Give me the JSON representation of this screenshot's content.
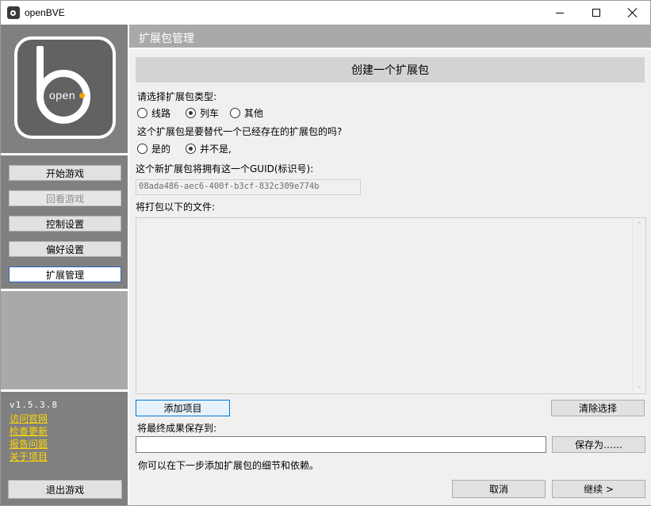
{
  "window": {
    "title": "openBVE"
  },
  "sidebar": {
    "logo_text": "open",
    "nav": [
      {
        "label": "开始游戏",
        "state": "normal"
      },
      {
        "label": "回看游戏",
        "state": "disabled"
      },
      {
        "label": "控制设置",
        "state": "normal"
      },
      {
        "label": "偏好设置",
        "state": "normal"
      },
      {
        "label": "扩展管理",
        "state": "active"
      }
    ],
    "version": "v1.5.3.8",
    "links": [
      "访问官网",
      "检查更新",
      "报告问题",
      "关于项目"
    ],
    "exit_label": "退出游戏"
  },
  "main": {
    "header": "扩展包管理",
    "section_title": "创建一个扩展包",
    "type_prompt": "请选择扩展包类型:",
    "type_options": [
      {
        "label": "线路",
        "checked": false
      },
      {
        "label": "列车",
        "checked": true
      },
      {
        "label": "其他",
        "checked": false
      }
    ],
    "replace_prompt": "这个扩展包是要替代一个已经存在的扩展包的吗?",
    "replace_options": [
      {
        "label": "是的",
        "checked": false
      },
      {
        "label": "并不是,",
        "checked": true
      }
    ],
    "guid_prompt": "这个新扩展包将拥有这一个GUID(标识号):",
    "guid_value": "08ada486-aec6-400f-b3cf-832c309e774b",
    "files_prompt": "将打包以下的文件:",
    "add_item_label": "添加项目",
    "clear_selection_label": "清除选择",
    "save_prompt": "将最终成果保存到:",
    "save_path_value": "",
    "save_as_label": "保存为……",
    "info_text": "你可以在下一步添加扩展包的细节和依赖。",
    "cancel_label": "取消",
    "continue_label": "继续 >"
  }
}
